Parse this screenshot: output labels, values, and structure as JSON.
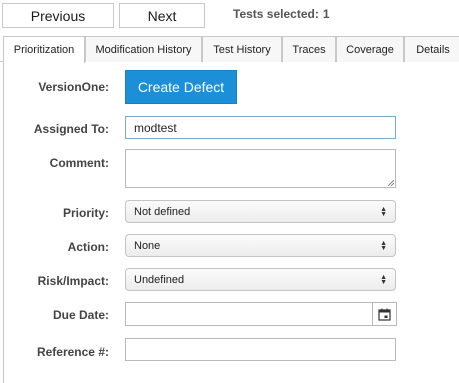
{
  "nav": {
    "previous_label": "Previous",
    "next_label": "Next",
    "tests_selected_label": "Tests selected:",
    "tests_selected_count": "1"
  },
  "tabs": [
    {
      "label": "Prioritization",
      "active": true
    },
    {
      "label": "Modification History",
      "active": false
    },
    {
      "label": "Test History",
      "active": false
    },
    {
      "label": "Traces",
      "active": false
    },
    {
      "label": "Coverage",
      "active": false
    },
    {
      "label": "Details",
      "active": false
    }
  ],
  "form": {
    "versionone_label": "VersionOne:",
    "create_defect_label": "Create Defect",
    "assigned_to_label": "Assigned To:",
    "assigned_to_value": "modtest",
    "comment_label": "Comment:",
    "comment_value": "",
    "priority_label": "Priority:",
    "priority_value": "Not defined",
    "action_label": "Action:",
    "action_value": "None",
    "risk_label": "Risk/Impact:",
    "risk_value": "Undefined",
    "due_date_label": "Due Date:",
    "due_date_value": "",
    "reference_label": "Reference #:",
    "reference_value": ""
  },
  "colors": {
    "create_defect_bg": "#1b8fd8",
    "label_text": "#444444",
    "border": "#c8c8c8"
  },
  "icons": {
    "select_arrows": "up-down-arrows-icon",
    "date_picker": "calendar-icon"
  }
}
